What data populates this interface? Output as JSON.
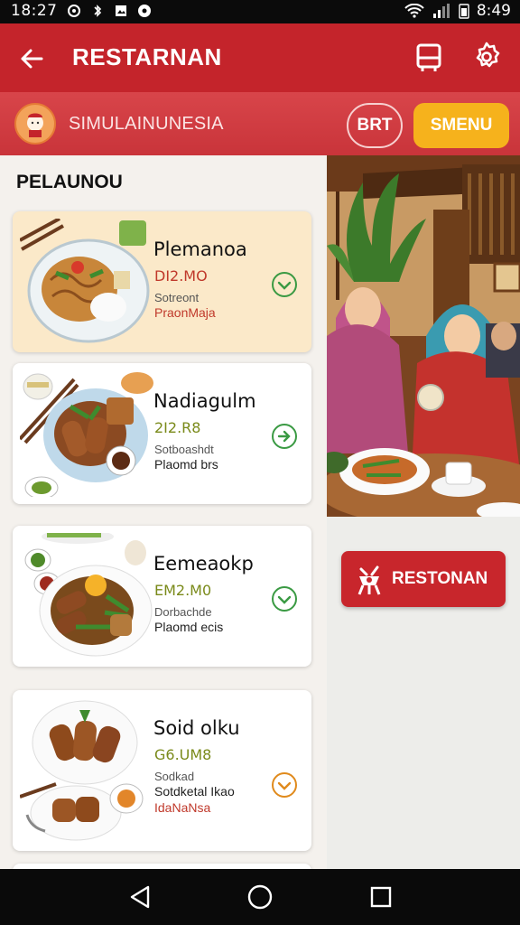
{
  "status_bar": {
    "time_left": "18:27",
    "time_right": "8:49"
  },
  "app_bar": {
    "title": "RESTARNAN"
  },
  "sub_bar": {
    "brand": "SIMULAINUNESIA",
    "button_outline": "BRT",
    "button_primary": "SMENU"
  },
  "section": {
    "title": "PELAUNOU"
  },
  "cards": [
    {
      "name": "Plemanoa",
      "price": "DI2.MO",
      "sub": "Sotreont",
      "tag": "PraonMaja",
      "price_color": "#c0392b",
      "tag_color": "#c0392b",
      "icon": "chevron-down-icon"
    },
    {
      "name": "Nadiagulm",
      "price": "2I2.R8",
      "sub": "Sotboashdt",
      "tag": "Plaomd brs",
      "price_color": "#7a8a1a",
      "tag_color": "#222222",
      "icon": "arrow-right-icon"
    },
    {
      "name": "Eemeaokp",
      "price": "EM2.M0",
      "sub": "Dorbachde",
      "tag": "Plaomd ecis",
      "price_color": "#7a8a1a",
      "tag_color": "#222222",
      "icon": "chevron-down-icon"
    },
    {
      "name": "Soid olku",
      "price": "G6.UM8",
      "sub": "Sodkad",
      "tag": "Sotdketal Ikao",
      "tag2": "IdaNaNsa",
      "price_color": "#7a8a1a",
      "tag_color": "#222222",
      "icon": "chevron-down-icon"
    }
  ],
  "cta": {
    "label": "RESTONAN"
  },
  "colors": {
    "primary": "#c4242b",
    "accent": "#f6b21c",
    "chevron_green": "#3a9a43",
    "chevron_orange": "#e08a1c"
  }
}
